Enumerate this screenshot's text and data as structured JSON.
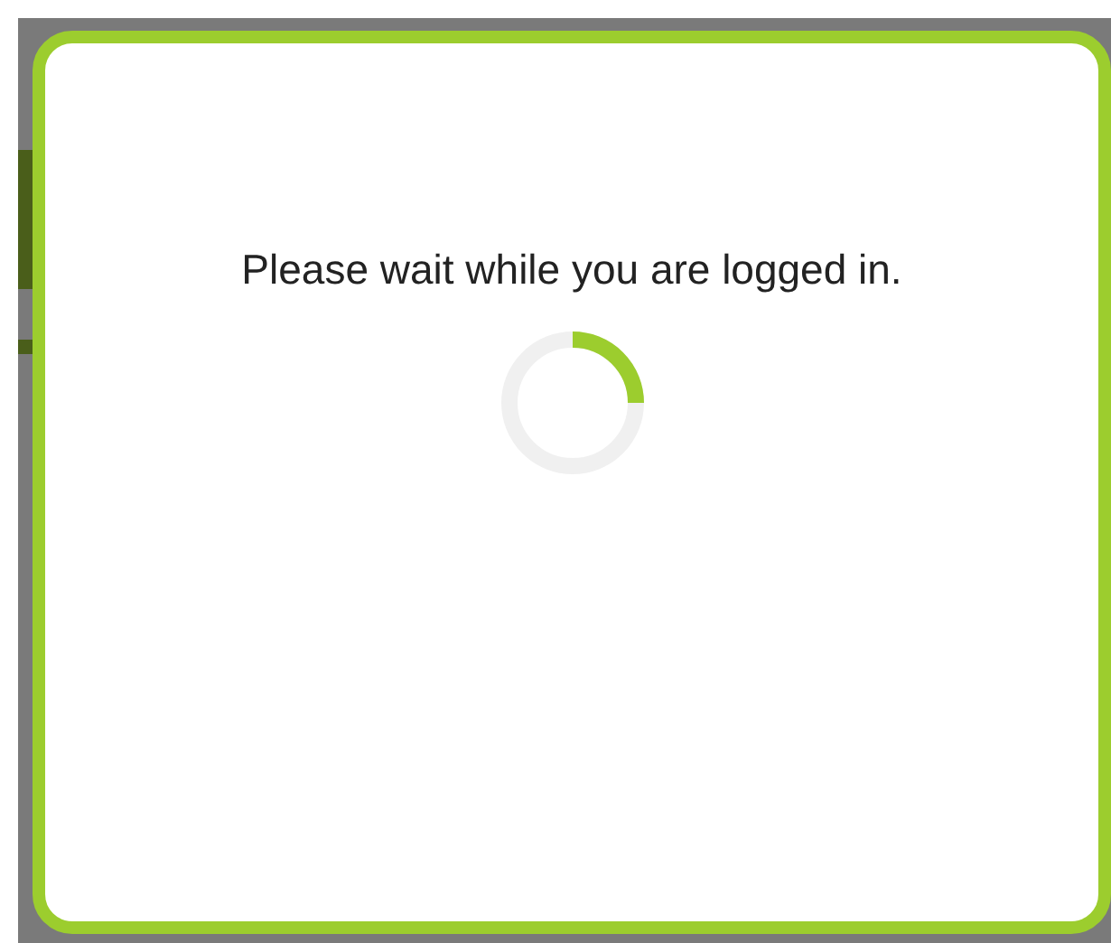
{
  "dialog": {
    "message": "Please wait while you are logged in."
  }
}
